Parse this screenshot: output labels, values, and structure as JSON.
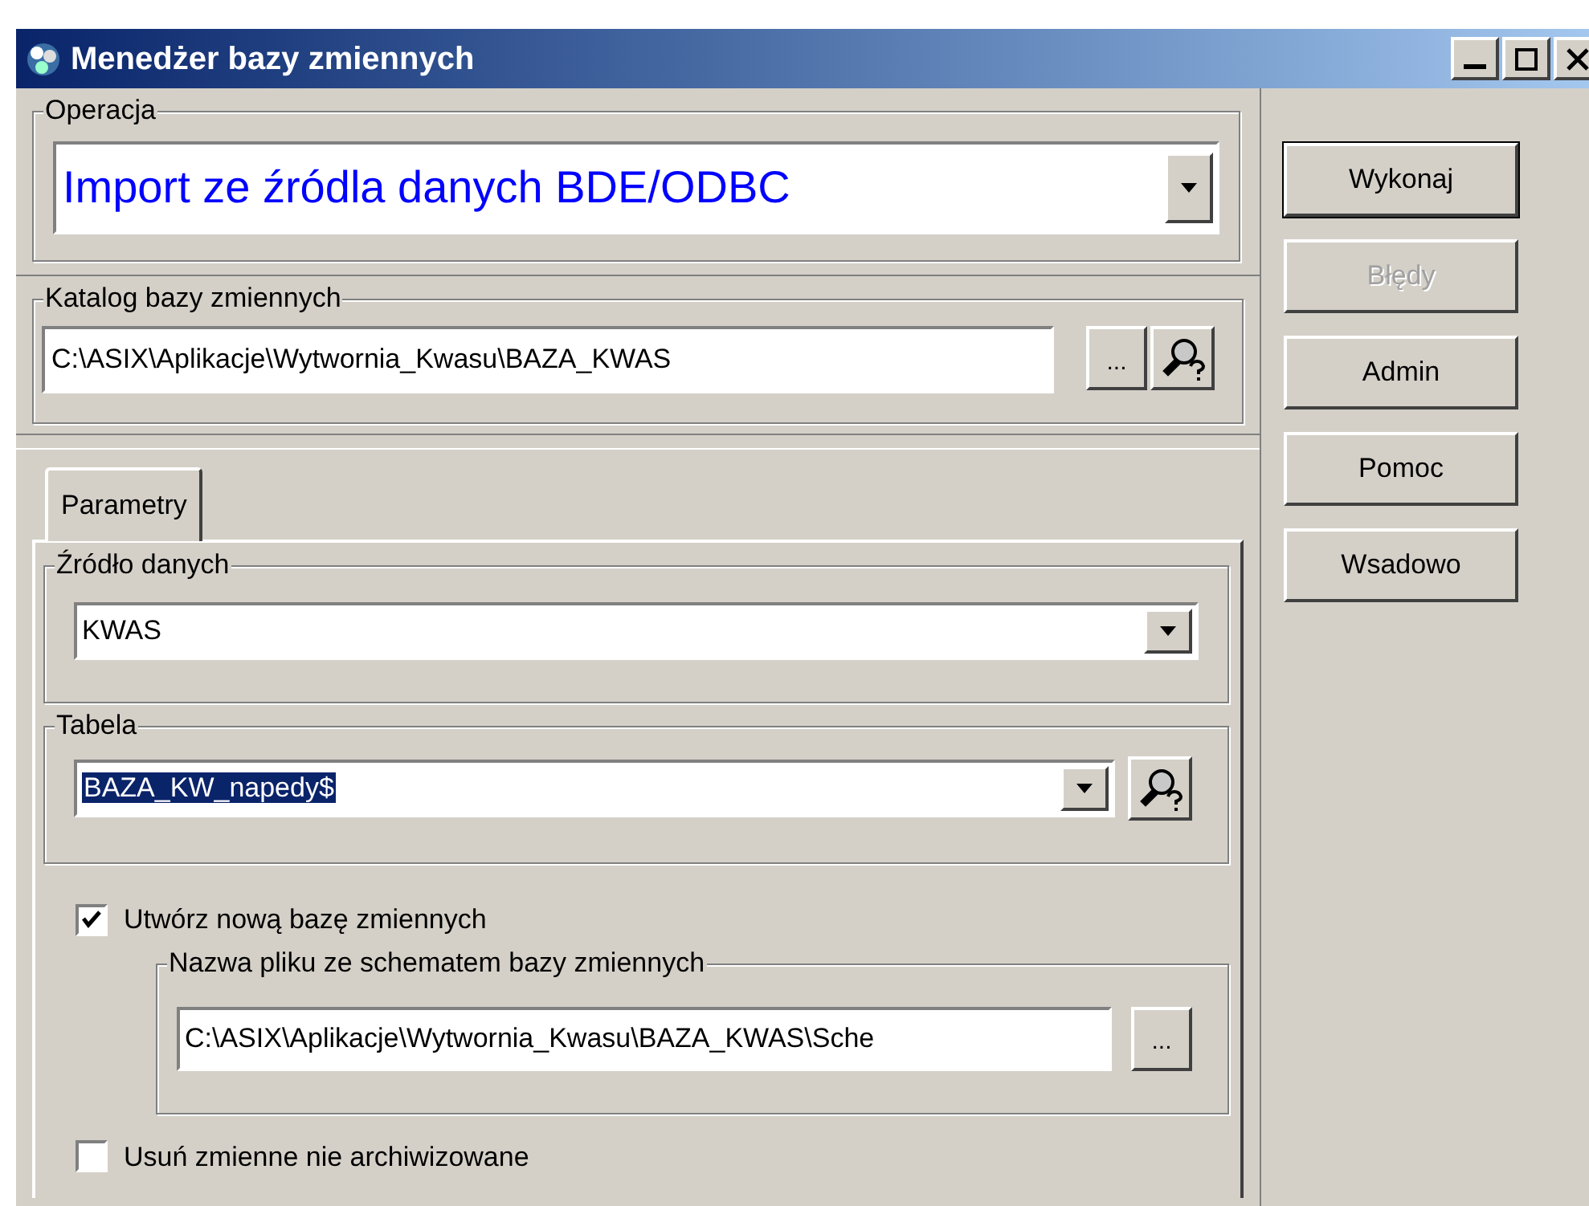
{
  "window": {
    "title": "Menedżer bazy zmiennych"
  },
  "operation": {
    "label": "Operacja",
    "value": "Import ze źródla danych BDE/ODBC"
  },
  "catalog": {
    "label": "Katalog bazy zmiennych",
    "value": "C:\\ASIX\\Aplikacje\\Wytwornia_Kwasu\\BAZA_KWAS",
    "browse": "..."
  },
  "tabs": [
    {
      "label": "Parametry",
      "selected": true
    }
  ],
  "source": {
    "label": "Źródło danych",
    "value": "KWAS"
  },
  "table": {
    "label": "Tabela",
    "value": "BAZA_KW_napedy$",
    "highlighted": true
  },
  "create_new": {
    "label": "Utwórz nową bazę zmiennych",
    "checked": true
  },
  "schema_file": {
    "label": "Nazwa pliku ze schematem bazy zmiennych",
    "value": "C:\\ASIX\\Aplikacje\\Wytwornia_Kwasu\\BAZA_KWAS\\Sche",
    "browse": "..."
  },
  "remove_unarchived": {
    "label": "Usuń zmienne nie archiwizowane",
    "checked": false
  },
  "buttons": [
    {
      "label": "Wykonaj",
      "disabled": false,
      "default": true
    },
    {
      "label": "Błędy",
      "disabled": true,
      "default": false
    },
    {
      "label": "Admin",
      "disabled": false,
      "default": false
    },
    {
      "label": "Pomoc",
      "disabled": false,
      "default": false
    },
    {
      "label": "Wsadowo",
      "disabled": false,
      "default": false
    }
  ]
}
